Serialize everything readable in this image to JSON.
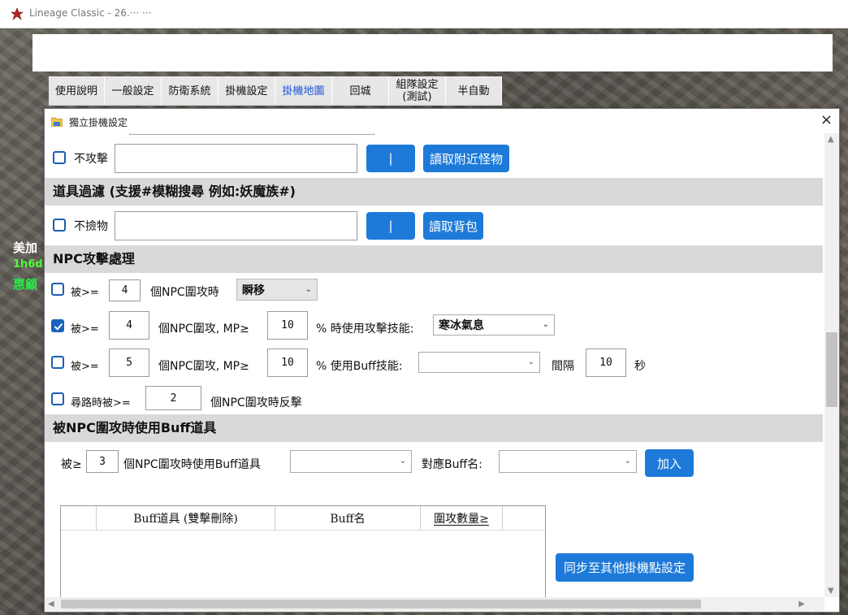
{
  "window": {
    "title": "Lineage Classic - 26.··· ···"
  },
  "tabs": [
    {
      "label": "使用說明",
      "active": false
    },
    {
      "label": "一般設定",
      "active": false
    },
    {
      "label": "防衛系統",
      "active": false
    },
    {
      "label": "掛機設定",
      "active": false
    },
    {
      "label": "掛機地圖",
      "active": true
    },
    {
      "label": "回城",
      "active": false
    },
    {
      "label": "組隊設定\n(測試)",
      "active": false
    },
    {
      "label": "半自動",
      "active": false
    }
  ],
  "game_labels": {
    "player_a": "美加",
    "player_b": "1h6d",
    "player_c": "惠顧"
  },
  "dialog": {
    "title": "獨立掛機設定",
    "close": "×",
    "no_attack": {
      "label": "不攻擊",
      "checked": false,
      "value": "",
      "sep_button": "|",
      "read_button": "讀取附近怪物"
    },
    "item_filter": {
      "header": "道具過濾 (支援#模糊搜尋 例如:妖魔族#)",
      "no_pickup": {
        "label": "不撿物",
        "checked": false,
        "value": "",
        "sep_button": "|",
        "read_button": "讀取背包"
      }
    },
    "npc": {
      "header": "NPC攻擊處理",
      "row1": {
        "checked": false,
        "prefix": "被>=",
        "count": "4",
        "text": "個NPC圍攻時",
        "action": "瞬移"
      },
      "row2": {
        "checked": true,
        "prefix": "被>=",
        "count": "4",
        "text": "個NPC圍攻, MP≥",
        "mp": "10",
        "text2": "% 時使用攻擊技能:",
        "skill": "寒冰氣息"
      },
      "row3": {
        "checked": false,
        "prefix": "被>=",
        "count": "5",
        "text": "個NPC圍攻, MP≥",
        "mp": "10",
        "text2": "% 使用Buff技能:",
        "skill": "",
        "interval_label": "間隔",
        "interval": "10",
        "unit": "秒"
      },
      "row4": {
        "checked": false,
        "prefix": "尋路時被>=",
        "count": "2",
        "text": "個NPC圍攻時反擊"
      }
    },
    "buff_item": {
      "header": "被NPC圍攻時使用Buff道具",
      "prefix": "被≥",
      "count": "3",
      "text": "個NPC圍攻時使用Buff道具",
      "item": "",
      "buff_label": "對應Buff名:",
      "buff_name": "",
      "add_button": "加入",
      "columns": [
        "Buff道具 (雙擊刪除)",
        "Buff名",
        "圍攻數量≥"
      ],
      "rows": [],
      "sync_button": "同步至其他掛機點設定"
    }
  },
  "colors": {
    "accent": "#1e7ad9",
    "active_tab": "#1f55d8",
    "section": "#d9d9d9"
  }
}
